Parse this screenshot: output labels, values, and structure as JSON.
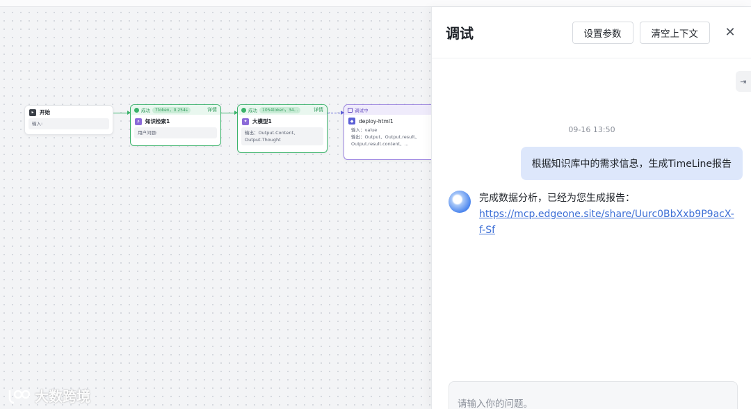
{
  "workflow": {
    "nodes": [
      {
        "title": "开始",
        "body": "输入:"
      },
      {
        "status": "成功",
        "metrics": "7token，0.254s",
        "detail": "详情",
        "title": "知识检索1",
        "body": "用户问题:"
      },
      {
        "status": "成功",
        "metrics": "1054token，34...",
        "detail": "详情",
        "title": "大模型1",
        "body_lines": [
          "输出：Output.Content、",
          "Output.Thought"
        ]
      },
      {
        "status": "调试中",
        "title": "deploy-html1",
        "body_lines": [
          "输入：value",
          "输出：Output、Output.result、",
          "Output.result.content、..."
        ]
      }
    ]
  },
  "panel": {
    "title": "调试",
    "set_params_label": "设置参数",
    "clear_context_label": "清空上下文",
    "close_glyph": "✕",
    "side_tab_glyph": "⇥",
    "timestamp": "09-16 13:50",
    "user_message": "根据知识库中的需求信息，生成TimeLine报告",
    "bot_message": {
      "text": "完成数据分析，已经为您生成报告：",
      "link": "https://mcp.edgeone.site/share/Uurc0BbXxb9P9acX-f-Sf"
    },
    "input_placeholder": "请输入你的问题。"
  },
  "brand": {
    "name": "大数跨境"
  },
  "colors": {
    "success": "#3bb36b",
    "debugging": "#9b83e0",
    "user_bubble": "#dde7fb",
    "link": "#3d6fd6"
  }
}
